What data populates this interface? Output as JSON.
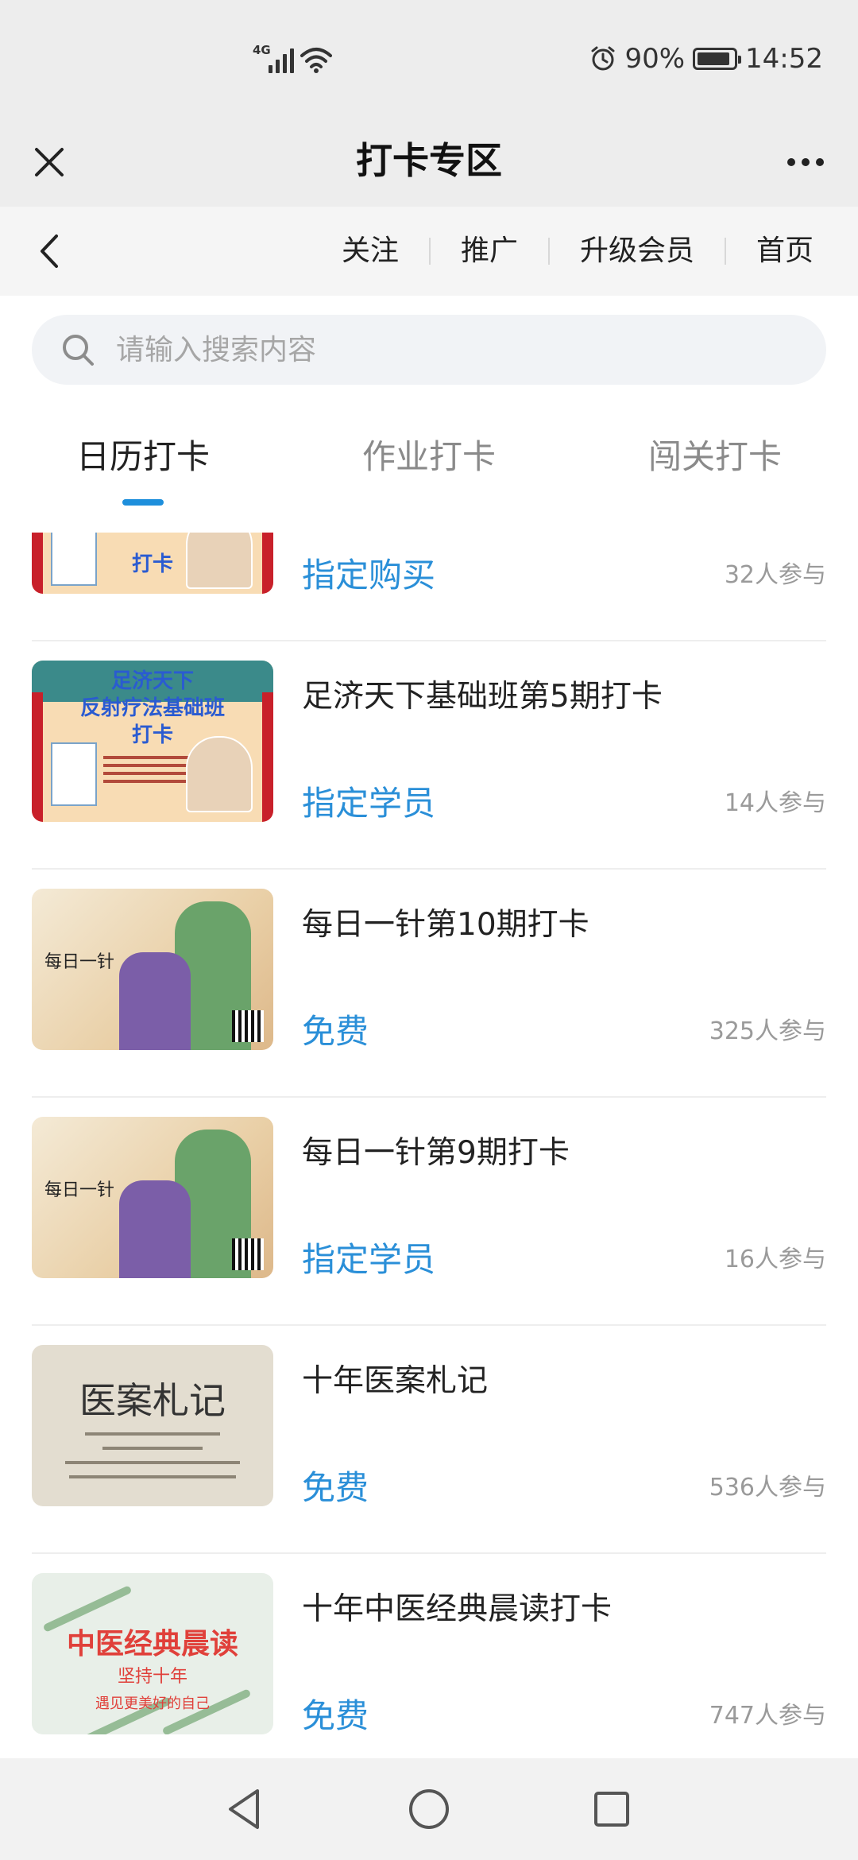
{
  "status_bar": {
    "network_label": "4G",
    "battery": "90%",
    "time": "14:52"
  },
  "title_bar": {
    "title": "打卡专区"
  },
  "nav": {
    "links": [
      "关注",
      "推广",
      "升级会员",
      "首页"
    ]
  },
  "search": {
    "placeholder": "请输入搜索内容"
  },
  "tabs": [
    "日历打卡",
    "作业打卡",
    "闯关打卡"
  ],
  "active_tab": "日历打卡",
  "items": [
    {
      "title": "",
      "tag": "指定购买",
      "count": "32人参与",
      "thumb_text": [
        "打卡"
      ]
    },
    {
      "title": "足济天下基础班第5期打卡",
      "tag": "指定学员",
      "count": "14人参与",
      "thumb_text": [
        "足济天下",
        "反射疗法基础班",
        "打卡"
      ]
    },
    {
      "title": "每日一针第10期打卡",
      "tag": "免费",
      "count": "325人参与",
      "thumb_text": [
        "每日一针"
      ]
    },
    {
      "title": "每日一针第9期打卡",
      "tag": "指定学员",
      "count": "16人参与",
      "thumb_text": [
        "每日一针"
      ]
    },
    {
      "title": "十年医案札记",
      "tag": "免费",
      "count": "536人参与",
      "thumb_text": [
        "医案札记"
      ]
    },
    {
      "title": "十年中医经典晨读打卡",
      "tag": "免费",
      "count": "747人参与",
      "thumb_text": [
        "中医经典晨读",
        "坚持十年",
        "遇见更美好的自己"
      ]
    }
  ],
  "colors": {
    "accent": "#2a8fd8",
    "tab_indicator": "#1e8fdc",
    "header_bg": "#ededed"
  },
  "icons": [
    "signal-icon",
    "wifi-icon",
    "alarm-icon",
    "battery-icon",
    "close-icon",
    "more-icon",
    "back-icon",
    "search-icon",
    "nav-back-icon",
    "nav-home-icon",
    "nav-recent-icon"
  ]
}
